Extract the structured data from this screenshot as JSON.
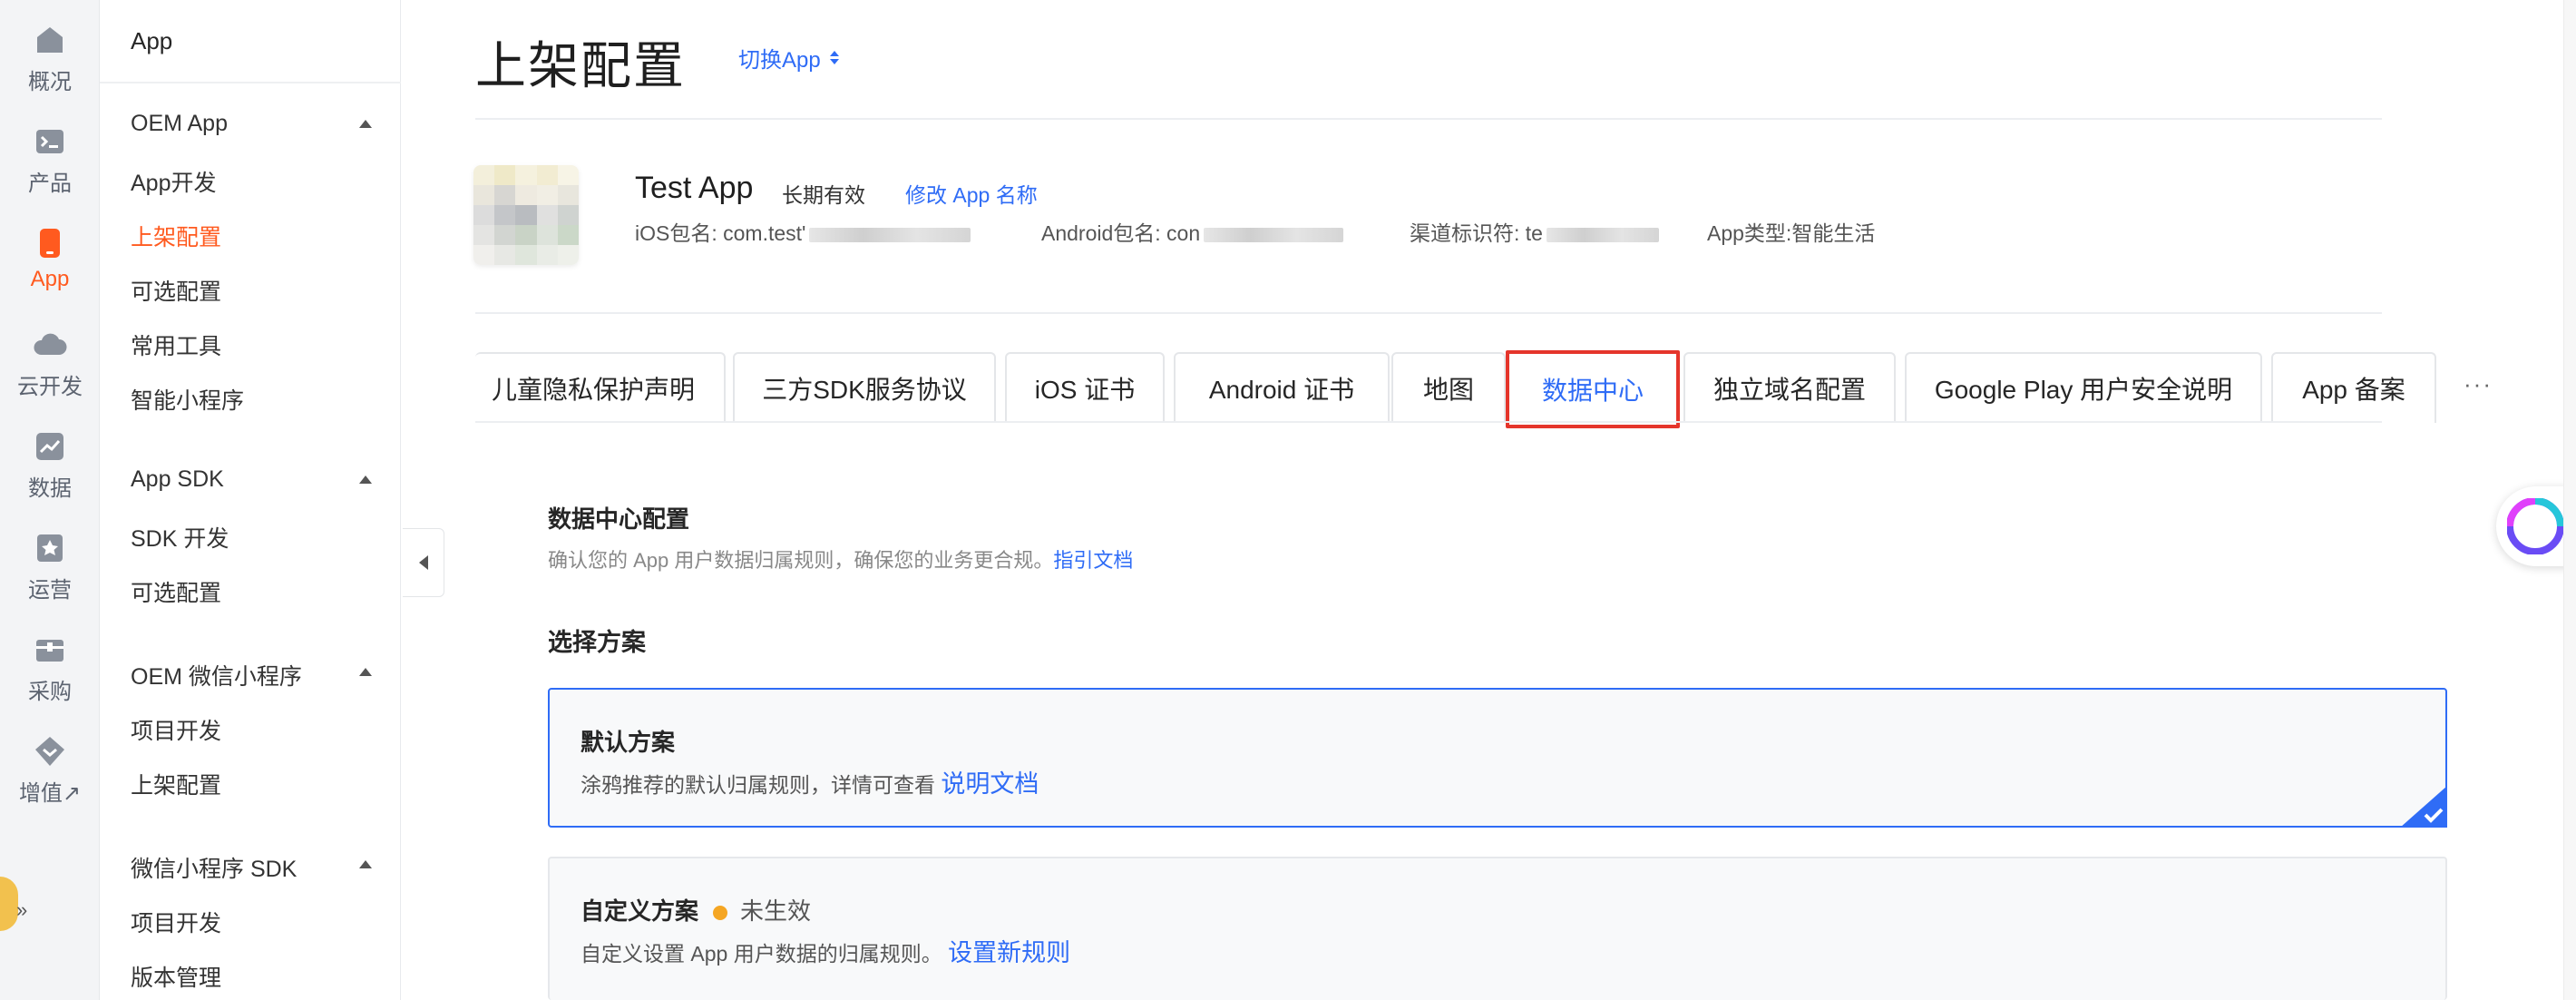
{
  "rail": {
    "items": [
      {
        "label": "概况",
        "icon": "home-icon"
      },
      {
        "label": "产品",
        "icon": "terminal-icon"
      },
      {
        "label": "App",
        "icon": "phone-icon",
        "active": true
      },
      {
        "label": "云开发",
        "icon": "cloud-icon"
      },
      {
        "label": "数据",
        "icon": "chart-icon"
      },
      {
        "label": "运营",
        "icon": "bookmark-icon"
      },
      {
        "label": "采购",
        "icon": "box-icon"
      },
      {
        "label": "增值↗",
        "icon": "diamond-icon"
      }
    ],
    "expand_glyph": "»",
    "accent_color": "#ff5a1f"
  },
  "menu": {
    "top_label": "App",
    "groups": [
      {
        "title": "OEM App",
        "items": [
          "App开发",
          "上架配置",
          "可选配置",
          "常用工具",
          "智能小程序"
        ]
      },
      {
        "title": "App SDK",
        "items": [
          "SDK 开发",
          "可选配置"
        ]
      },
      {
        "title": "OEM 微信小程序",
        "items": [
          "项目开发",
          "上架配置"
        ]
      },
      {
        "title": "微信小程序 SDK",
        "items": [
          "项目开发",
          "版本管理"
        ]
      }
    ],
    "active_item": "上架配置"
  },
  "header": {
    "title": "上架配置",
    "switch_label": "切换App"
  },
  "app_info": {
    "name": "Test App",
    "validity": "长期有效",
    "rename_label": "修改 App 名称",
    "ios_label": "iOS包名: com.test'",
    "android_label": "Android包名: con",
    "channel_label": "渠道标识符: te",
    "type_label": "App类型:智能生活"
  },
  "tabs": {
    "items": [
      "儿童隐私保护声明",
      "三方SDK服务协议",
      "iOS 证书",
      "Android 证书",
      "地图",
      "数据中心",
      "独立域名配置",
      "Google Play 用户安全说明",
      "App 备案"
    ],
    "active": "数据中心",
    "more": "···"
  },
  "content": {
    "section_title": "数据中心配置",
    "section_desc": "确认您的 App 用户数据归属规则，确保您的业务更合规。",
    "section_link": "指引文档",
    "plan_title": "选择方案",
    "default_plan": {
      "title": "默认方案",
      "desc": "涂鸦推荐的默认归属规则，详情可查看",
      "link": "说明文档",
      "selected": true
    },
    "custom_plan": {
      "title": "自定义方案",
      "status": "未生效",
      "desc": "自定义设置 App 用户数据的归属规则。",
      "link": "设置新规则"
    }
  },
  "colors": {
    "link": "#2f6cf6",
    "highlight": "#e5352b",
    "status_dot": "#f5a623"
  }
}
